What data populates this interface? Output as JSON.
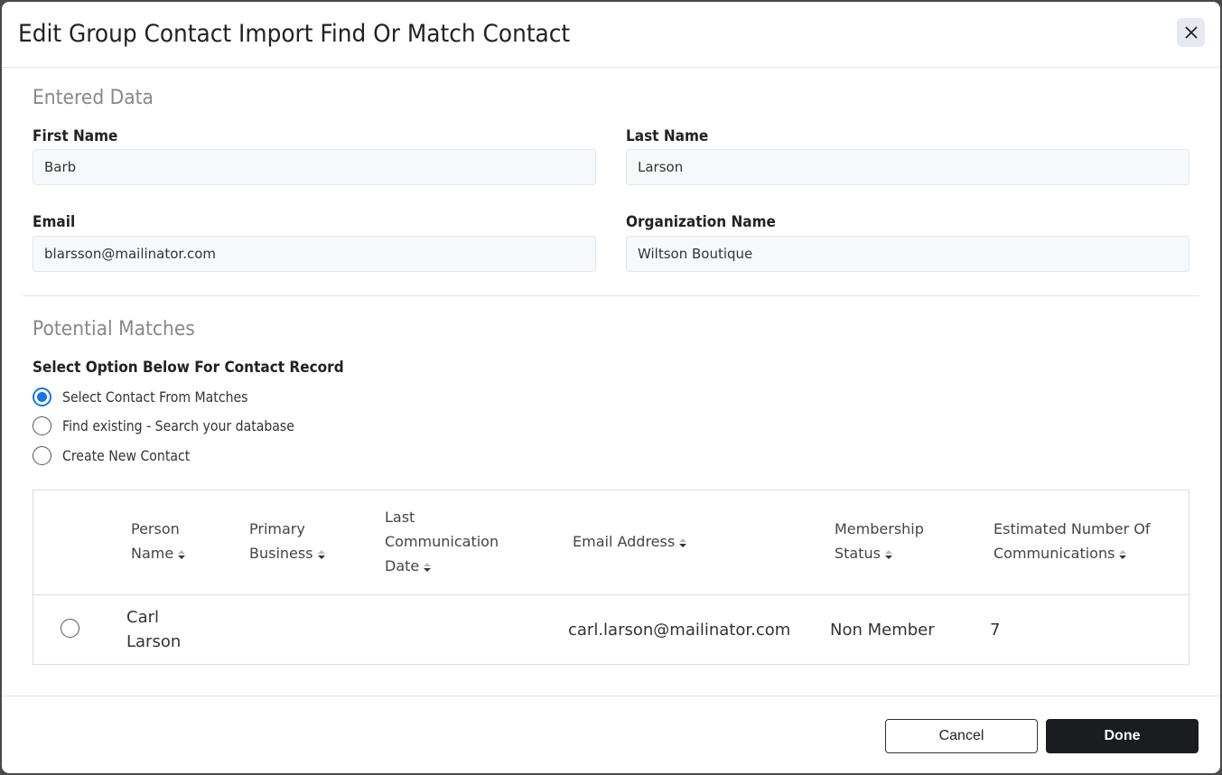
{
  "modal": {
    "title": "Edit Group Contact Import Find Or Match Contact",
    "close_icon": "close-icon"
  },
  "entered_data": {
    "section_title": "Entered Data",
    "fields": {
      "first_name": {
        "label": "First Name",
        "value": "Barb"
      },
      "last_name": {
        "label": "Last Name",
        "value": "Larson"
      },
      "email": {
        "label": "Email",
        "value": "blarsson@mailinator.com"
      },
      "organization_name": {
        "label": "Organization Name",
        "value": "Wiltson Boutique"
      }
    }
  },
  "potential_matches": {
    "section_title": "Potential Matches",
    "options_label": "Select Option Below For Contact Record",
    "options": [
      {
        "label": "Select Contact From Matches",
        "selected": true
      },
      {
        "label": "Find existing - Search your database",
        "selected": false
      },
      {
        "label": "Create New Contact",
        "selected": false
      }
    ],
    "table": {
      "columns": [
        {
          "line1": "Person",
          "line2": "Name"
        },
        {
          "line1": "Primary",
          "line2": "Business"
        },
        {
          "line1": "Last",
          "line2": "Communication",
          "line3": "Date"
        },
        {
          "line1": "Email Address"
        },
        {
          "line1": "Membership",
          "line2": "Status"
        },
        {
          "line1": "Estimated Number Of",
          "line2": "Communications"
        }
      ],
      "rows": [
        {
          "selected": false,
          "person_first": "Carl",
          "person_last": "Larson",
          "primary_business": "",
          "last_communication_date": "",
          "email_address": "carl.larson@mailinator.com",
          "membership_status": "Non Member",
          "estimated_communications": "7"
        }
      ]
    }
  },
  "footer": {
    "cancel_label": "Cancel",
    "done_label": "Done"
  },
  "colors": {
    "accent": "#1a73e8",
    "primary_button": "#1b1c1f"
  }
}
